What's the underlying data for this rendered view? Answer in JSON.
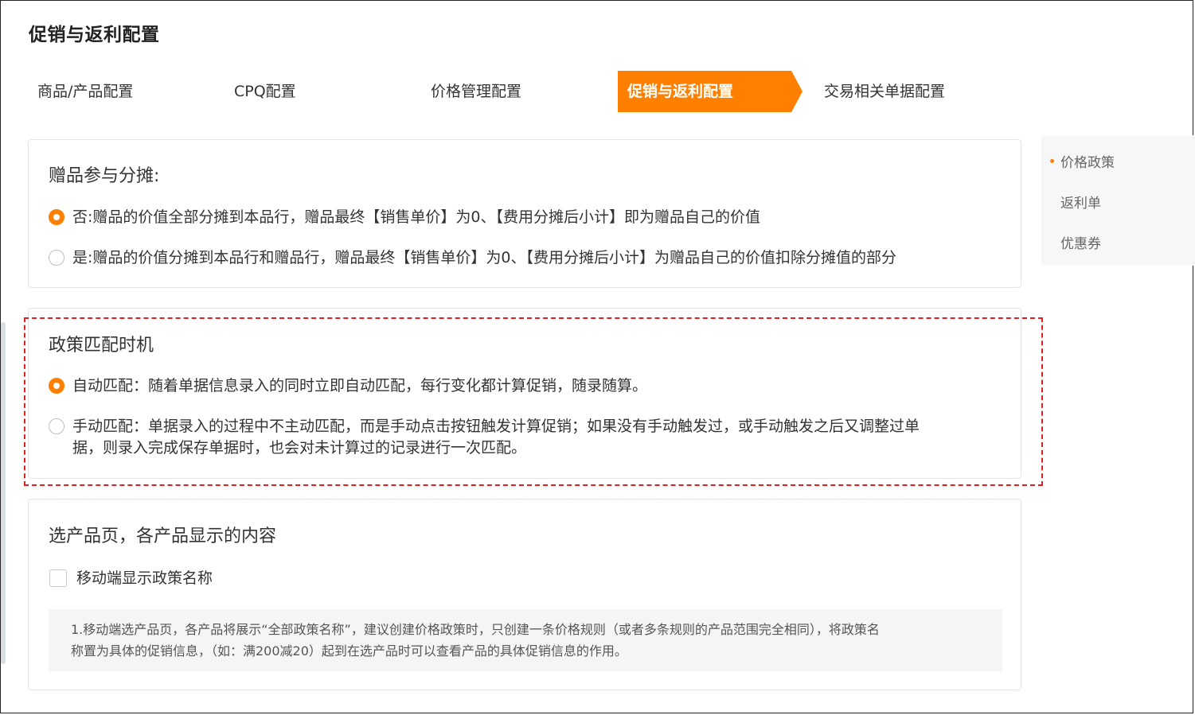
{
  "page": {
    "title": "促销与返利配置"
  },
  "steps": [
    {
      "label": "商品/产品配置",
      "active": false
    },
    {
      "label": "CPQ配置",
      "active": false
    },
    {
      "label": "价格管理配置",
      "active": false
    },
    {
      "label": "促销与返利配置",
      "active": true
    },
    {
      "label": "交易相关单据配置",
      "active": false
    }
  ],
  "gift_section": {
    "title": "赠品参与分摊:",
    "options": [
      {
        "label": "否:赠品的价值全部分摊到本品行，赠品最终【销售单价】为0、【费用分摊后小计】即为赠品自己的价值",
        "checked": true
      },
      {
        "label": "是:赠品的价值分摊到本品行和赠品行，赠品最终【销售单价】为0、【费用分摊后小计】为赠品自己的价值扣除分摊值的部分",
        "checked": false
      }
    ]
  },
  "match_section": {
    "title": "政策匹配时机",
    "options": [
      {
        "label": "自动匹配：随着单据信息录入的同时立即自动匹配，每行变化都计算促销，随录随算。",
        "checked": true
      },
      {
        "label_line1": "手动匹配：单据录入的过程中不主动匹配，而是手动点击按钮触发计算促销；如果没有手动触发过，或手动触发之后又调整过单",
        "label_line2": "据，则录入完成保存单据时，也会对未计算过的记录进行一次匹配。",
        "checked": false
      }
    ]
  },
  "product_section": {
    "title": "选产品页，各产品显示的内容",
    "checkbox_label": "移动端显示政策名称",
    "checked": false,
    "note_line1": "1.移动端选产品页，各产品将展示“全部政策名称”，建议创建价格政策时，只创建一条价格规则（或者多条规则的产品范围完全相同），将政策名",
    "note_line2": "称置为具体的促销信息，（如：满200减20）起到在选产品时可以查看产品的具体促销信息的作用。"
  },
  "side_nav": {
    "items": [
      "价格政策",
      "返利单",
      "优惠券"
    ],
    "active_index": 0
  },
  "colors": {
    "accent": "#ff8000",
    "highlight_border": "#e02020"
  }
}
